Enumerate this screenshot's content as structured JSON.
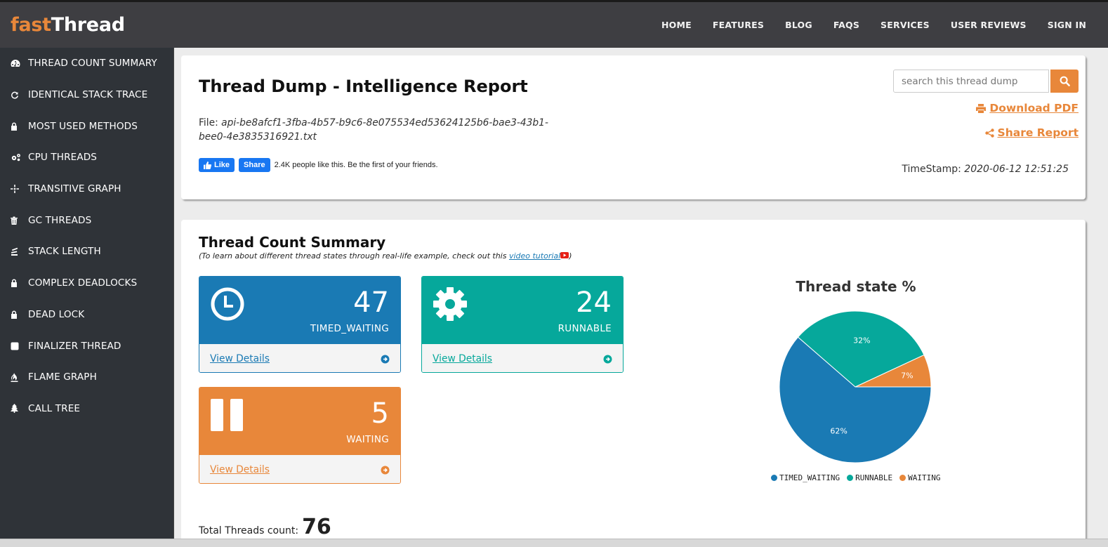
{
  "logo": {
    "part1": "fast",
    "part2": "Thread"
  },
  "nav": [
    {
      "label": "HOME"
    },
    {
      "label": "FEATURES"
    },
    {
      "label": "BLOG"
    },
    {
      "label": "FAQS"
    },
    {
      "label": "SERVICES"
    },
    {
      "label": "USER REVIEWS"
    },
    {
      "label": "SIGN IN"
    }
  ],
  "sidebar": {
    "items": [
      {
        "label": "THREAD COUNT SUMMARY",
        "icon": "dashboard-icon"
      },
      {
        "label": "IDENTICAL STACK TRACE",
        "icon": "refresh-icon"
      },
      {
        "label": "MOST USED METHODS",
        "icon": "lock-icon"
      },
      {
        "label": "CPU THREADS",
        "icon": "gears-icon"
      },
      {
        "label": "TRANSITIVE GRAPH",
        "icon": "crosshair-icon"
      },
      {
        "label": "GC THREADS",
        "icon": "trash-icon"
      },
      {
        "label": "STACK LENGTH",
        "icon": "stack-icon"
      },
      {
        "label": "COMPLEX DEADLOCKS",
        "icon": "lock-icon"
      },
      {
        "label": "DEAD LOCK",
        "icon": "lock-icon"
      },
      {
        "label": "FINALIZER THREAD",
        "icon": "square-icon"
      },
      {
        "label": "FLAME GRAPH",
        "icon": "fire-icon"
      },
      {
        "label": "CALL TREE",
        "icon": "tree-icon"
      }
    ]
  },
  "report": {
    "title": "Thread Dump - Intelligence Report",
    "file_label": "File:",
    "file_name": "api-be8afcf1-3fba-4b57-b9c6-8e075534ed53624125b6-bae3-43b1-bee0-4e3835316921.txt",
    "fb_like": "Like",
    "fb_share": "Share",
    "fb_text": "2.4K people like this. Be the first of your friends.",
    "search_placeholder": "search this thread dump",
    "download_pdf": "Download PDF",
    "share_report": "Share Report",
    "timestamp_label": "TimeStamp:",
    "timestamp_value": "2020-06-12 12:51:25"
  },
  "summary": {
    "title": "Thread Count Summary",
    "subtitle_pre": "(To learn about different thread states through real-life example, check out this ",
    "subtitle_link": "video tutorial",
    "subtitle_post": ")",
    "cards": [
      {
        "count": "47",
        "state": "TIMED_WAITING",
        "link": "View Details"
      },
      {
        "count": "24",
        "state": "RUNNABLE",
        "link": "View Details"
      },
      {
        "count": "5",
        "state": "WAITING",
        "link": "View Details"
      }
    ],
    "total_label": "Total Threads count:",
    "total_value": "76"
  },
  "colors": {
    "timed_waiting": "#1a7ab4",
    "runnable": "#06a89b",
    "waiting": "#e8873a"
  },
  "chart_data": {
    "type": "pie",
    "title": "Thread state %",
    "categories": [
      "TIMED_WAITING",
      "RUNNABLE",
      "WAITING"
    ],
    "values": [
      62,
      32,
      7
    ],
    "labels": [
      "62%",
      "32%",
      "7%"
    ],
    "colors": [
      "#1a7ab4",
      "#06a89b",
      "#e8873a"
    ],
    "legend": "bottom"
  }
}
